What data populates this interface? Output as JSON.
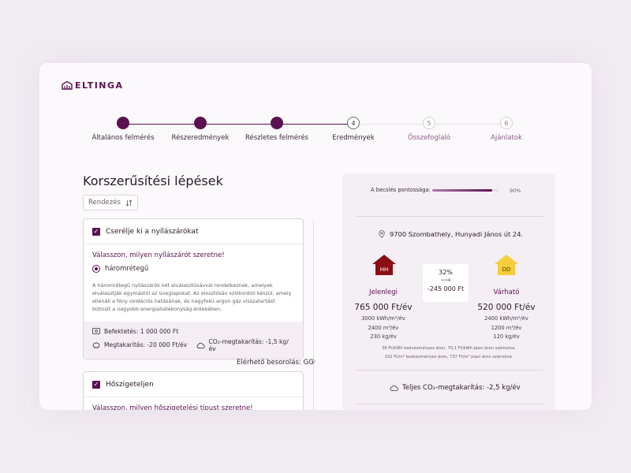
{
  "brand": {
    "name": "ELTINGA",
    "color": "#5b1151"
  },
  "stepper": {
    "steps": [
      {
        "num": "",
        "label": "Általános felmérés",
        "state": "done"
      },
      {
        "num": "",
        "label": "Részeredmények",
        "state": "done"
      },
      {
        "num": "",
        "label": "Részletes felmérés",
        "state": "done"
      },
      {
        "num": "4",
        "label": "Eredmények",
        "state": "active"
      },
      {
        "num": "5",
        "label": "Összefoglaló",
        "state": "todo"
      },
      {
        "num": "6",
        "label": "Ajánlatok",
        "state": "todo"
      }
    ]
  },
  "main": {
    "title": "Korszerűsítési lépések",
    "sort_label": "Rendezés",
    "sort_icon": "sort-arrows-icon",
    "cards": [
      {
        "title": "Cserélje ki a nyílászárókat",
        "question": "Válasszon, milyen nyílászárót szeretne!",
        "option": "háromrétegű",
        "description": "A háromrétegű nyílászárók két elválasztósávval rendelkeznek, amelyek elválasztják egymástól az üveglapokat. Az elosztósáv szilikonból készül, amely ellenáll a fény oxidációs hatásának, és nagyfokú argon gáz visszatartást biztosít a nagyobb energiahatékonyság érdekében.",
        "investment": "Befektetés: 1 000 000 Ft",
        "savings": "Megtakarítás: -20 000 Ft/év",
        "co2": "CO₂-megtakarítás: -1,5 kg/év"
      },
      {
        "title": "Hőszigeteljen",
        "question": "Válasszon, milyen hőszigetelési típust szeretne!"
      }
    ],
    "rating": "Elérhető besorolás: GG"
  },
  "panel": {
    "accuracy_label": "A becslés pontossága:",
    "accuracy_value": "90%",
    "accuracy_fraction": 0.9,
    "address": "9700 Szombathely, Hunyadi János út 24.",
    "current": {
      "badge": "HH",
      "badge_color": "#8a0f14",
      "title": "Jelenlegi",
      "cost": "765 000 Ft/év",
      "energy": "3000 kWh/m²/év",
      "gas": "2400 m³/év",
      "co2": "230 kg/év"
    },
    "expected": {
      "badge": "DD",
      "badge_color": "#f5cd3b",
      "title": "Várható",
      "cost": "520 000 Ft/év",
      "energy": "2400 kWh/m²/év",
      "gas": "1200 m³/év",
      "co2": "120 kg/év"
    },
    "delta_pct": "32%",
    "delta_arrow": "⟶",
    "delta_amount": "-245 000 Ft",
    "note1": "36 Ft/kWh kedvezményes áron, 70,1 Ft/kWh piaci áron számolva.",
    "note2": "102 Ft/m³ kedvezményes áron, 737 Ft/m³ piaci áron számolva.",
    "total_co2": "Teljes CO₂-megtakarítás: -2,5 kg/év"
  }
}
